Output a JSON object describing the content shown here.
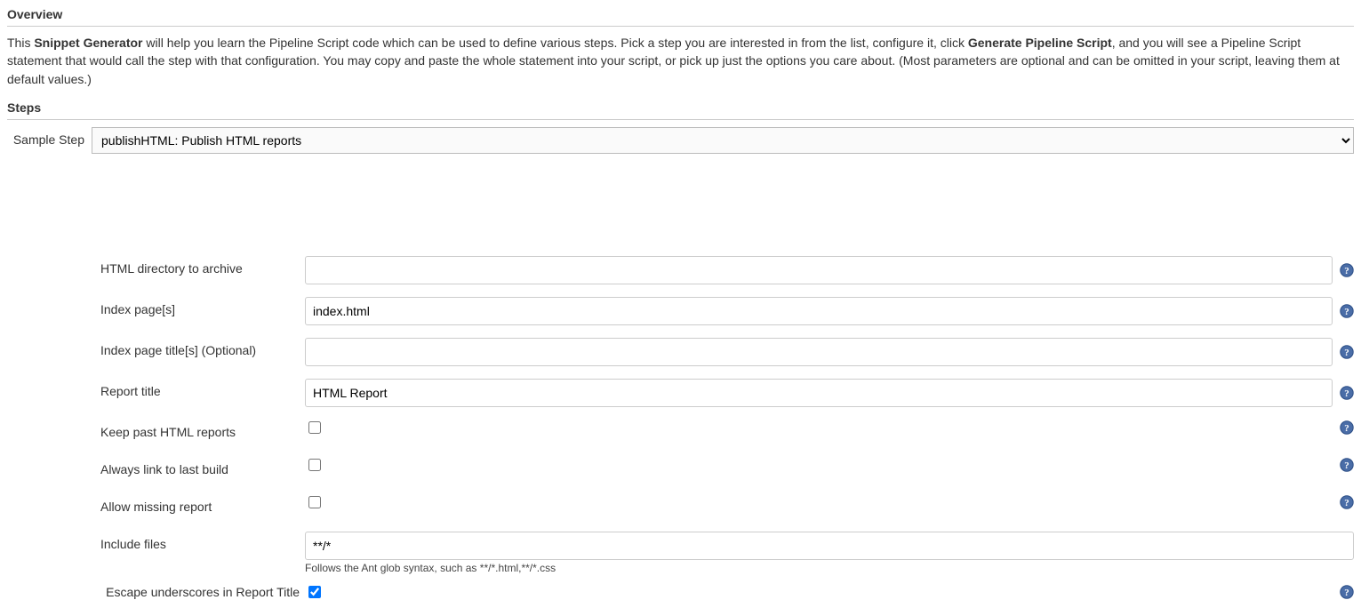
{
  "overview": {
    "title": "Overview",
    "text1": "This ",
    "bold1": "Snippet Generator",
    "text2": " will help you learn the Pipeline Script code which can be used to define various steps. Pick a step you are interested in from the list, configure it, click ",
    "bold2": "Generate Pipeline Script",
    "text3": ", and you will see a Pipeline Script statement that would call the step with that configuration. You may copy and paste the whole statement into your script, or pick up just the options you care about. (Most parameters are optional and can be omitted in your script, leaving them at default values.)"
  },
  "steps": {
    "title": "Steps",
    "sampleStepLabel": "Sample Step",
    "sampleStepValue": "publishHTML: Publish HTML reports"
  },
  "config": {
    "htmlDir": {
      "label": "HTML directory to archive",
      "value": ""
    },
    "indexPages": {
      "label": "Index page[s]",
      "value": "index.html"
    },
    "indexTitles": {
      "label": "Index page title[s] (Optional)",
      "value": ""
    },
    "reportTitle": {
      "label": "Report title",
      "value": "HTML Report"
    },
    "keepPast": {
      "label": "Keep past HTML reports",
      "checked": false
    },
    "alwaysLink": {
      "label": "Always link to last build",
      "checked": false
    },
    "allowMissing": {
      "label": "Allow missing report",
      "checked": false
    },
    "includeFiles": {
      "label": "Include files",
      "value": "**/*",
      "hint": "Follows the Ant glob syntax, such as **/*.html,**/*.css"
    },
    "escapeUnderscores": {
      "label": "Escape underscores in Report Title",
      "checked": true
    }
  }
}
